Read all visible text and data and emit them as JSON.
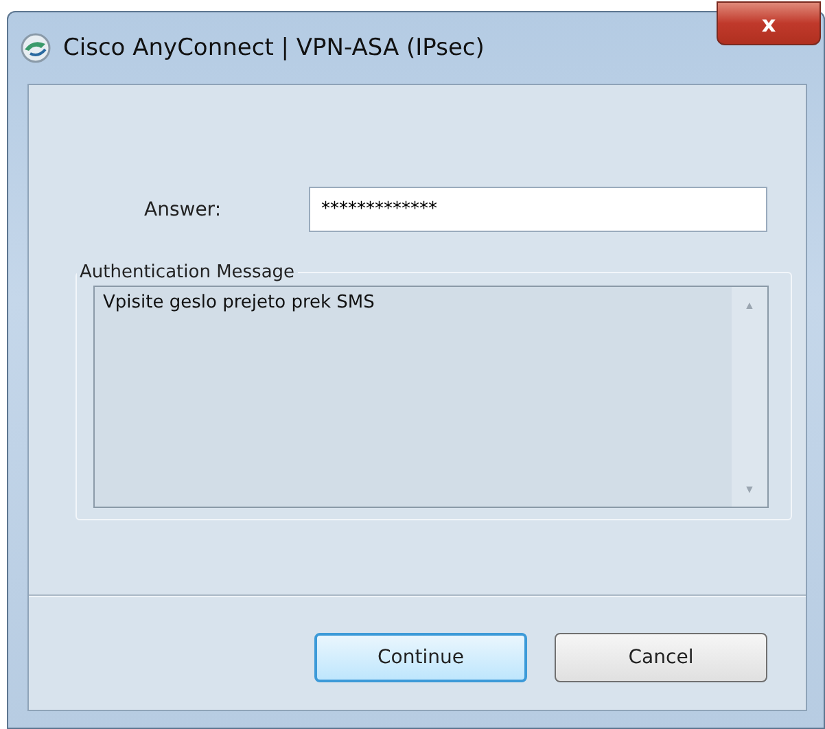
{
  "window": {
    "title": "Cisco AnyConnect | VPN-ASA (IPsec)",
    "close": "x"
  },
  "answer": {
    "label": "Answer:",
    "value": "*************"
  },
  "message": {
    "legend": "Authentication Message",
    "text": "Vpisite geslo prejeto prek SMS",
    "scroll_up": "▲",
    "scroll_down": "▼"
  },
  "buttons": [
    {
      "label": "Continue",
      "default": true
    },
    {
      "label": "Cancel",
      "default": false
    }
  ]
}
